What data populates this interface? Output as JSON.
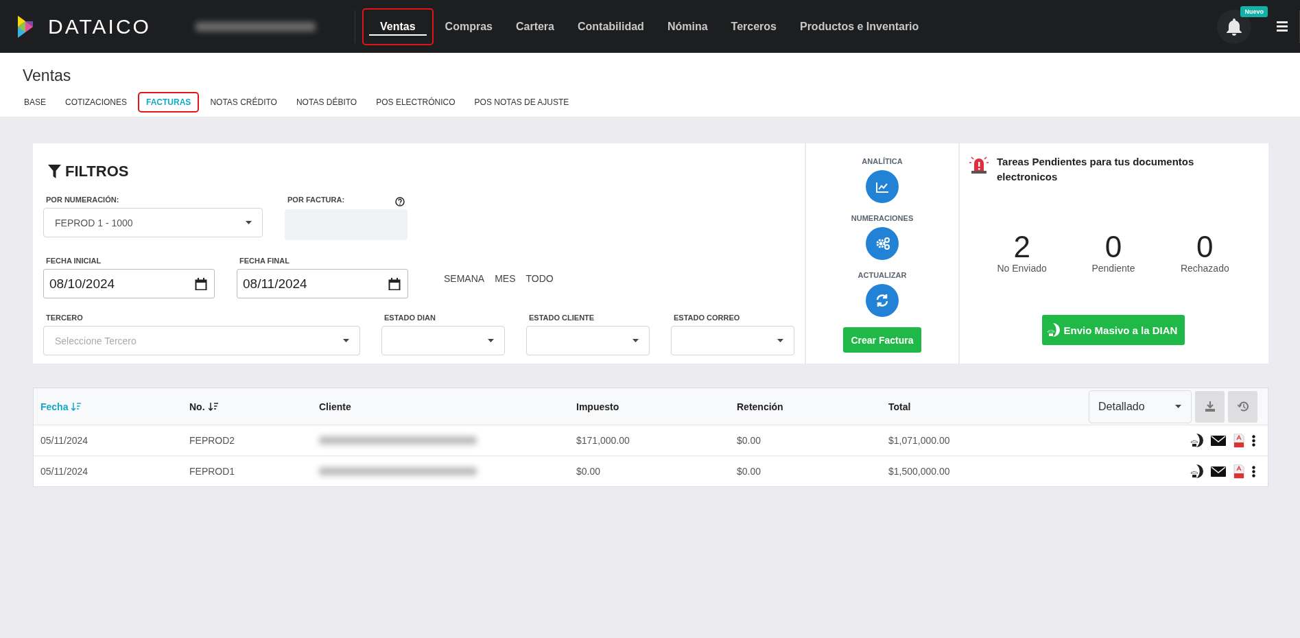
{
  "brand": {
    "name": "DATAICO"
  },
  "main_nav": [
    {
      "label": "Ventas",
      "selected": true,
      "highlighted": true
    },
    {
      "label": "Compras",
      "selected": false,
      "highlighted": false
    },
    {
      "label": "Cartera",
      "selected": false,
      "highlighted": false
    },
    {
      "label": "Contabilidad",
      "selected": false,
      "highlighted": false
    },
    {
      "label": "Nómina",
      "selected": false,
      "highlighted": false
    },
    {
      "label": "Terceros",
      "selected": false,
      "highlighted": false
    },
    {
      "label": "Productos e Inventario",
      "selected": false,
      "highlighted": false
    }
  ],
  "notifications": {
    "badge": "Nuevo"
  },
  "page": {
    "title": "Ventas"
  },
  "sub_tabs": [
    {
      "label": "BASE",
      "selected": false,
      "highlighted": false
    },
    {
      "label": "COTIZACIONES",
      "selected": false,
      "highlighted": false
    },
    {
      "label": "FACTURAS",
      "selected": true,
      "highlighted": true
    },
    {
      "label": "NOTAS CRÉDITO",
      "selected": false,
      "highlighted": false
    },
    {
      "label": "NOTAS DÉBITO",
      "selected": false,
      "highlighted": false
    },
    {
      "label": "POS ELECTRÓNICO",
      "selected": false,
      "highlighted": false
    },
    {
      "label": "POS NOTAS DE AJUSTE",
      "selected": false,
      "highlighted": false
    }
  ],
  "filters": {
    "title": "FILTROS",
    "numeracion": {
      "label": "POR NUMERACIÓN:",
      "value": "FEPROD 1 - 1000"
    },
    "factura": {
      "label": "POR FACTURA:"
    },
    "fecha_inicial": {
      "label": "FECHA INICIAL",
      "value": "08/10/2024"
    },
    "fecha_final": {
      "label": "FECHA FINAL",
      "value": "08/11/2024"
    },
    "quick_ranges": [
      "SEMANA",
      "MES",
      "TODO"
    ],
    "tercero": {
      "label": "TERCERO",
      "placeholder": "Seleccione Tercero"
    },
    "estados": [
      {
        "label": "ESTADO DIAN"
      },
      {
        "label": "ESTADO CLIENTE"
      },
      {
        "label": "ESTADO CORREO"
      }
    ]
  },
  "actions": {
    "items": [
      {
        "label": "ANALÍTICA",
        "kind": "chart"
      },
      {
        "label": "NUMERACIONES",
        "kind": "gears"
      },
      {
        "label": "ACTUALIZAR",
        "kind": "refresh"
      }
    ],
    "create_button": "Crear Factura"
  },
  "tasks": {
    "title": "Tareas Pendientes para tus documentos electronicos",
    "counters": [
      {
        "value": "2",
        "label": "No Enviado"
      },
      {
        "value": "0",
        "label": "Pendiente"
      },
      {
        "value": "0",
        "label": "Rechazado"
      }
    ],
    "button": "Envio Masivo a la DIAN"
  },
  "table": {
    "columns": [
      {
        "label": "Fecha",
        "sortable": true,
        "selected": true
      },
      {
        "label": "No.",
        "sortable": true,
        "selected": false
      },
      {
        "label": "Cliente",
        "sortable": false,
        "selected": false
      },
      {
        "label": "Impuesto",
        "sortable": false,
        "selected": false
      },
      {
        "label": "Retención",
        "sortable": false,
        "selected": false
      },
      {
        "label": "Total",
        "sortable": false,
        "selected": false
      }
    ],
    "view": "Detallado",
    "rows": [
      {
        "fecha": "05/11/2024",
        "numero": "FEPROD2",
        "impuesto": "$171,000.00",
        "retencion": "$0.00",
        "total": "$1,071,000.00"
      },
      {
        "fecha": "05/11/2024",
        "numero": "FEPROD1",
        "impuesto": "$0.00",
        "retencion": "$0.00",
        "total": "$1,500,000.00"
      }
    ]
  }
}
